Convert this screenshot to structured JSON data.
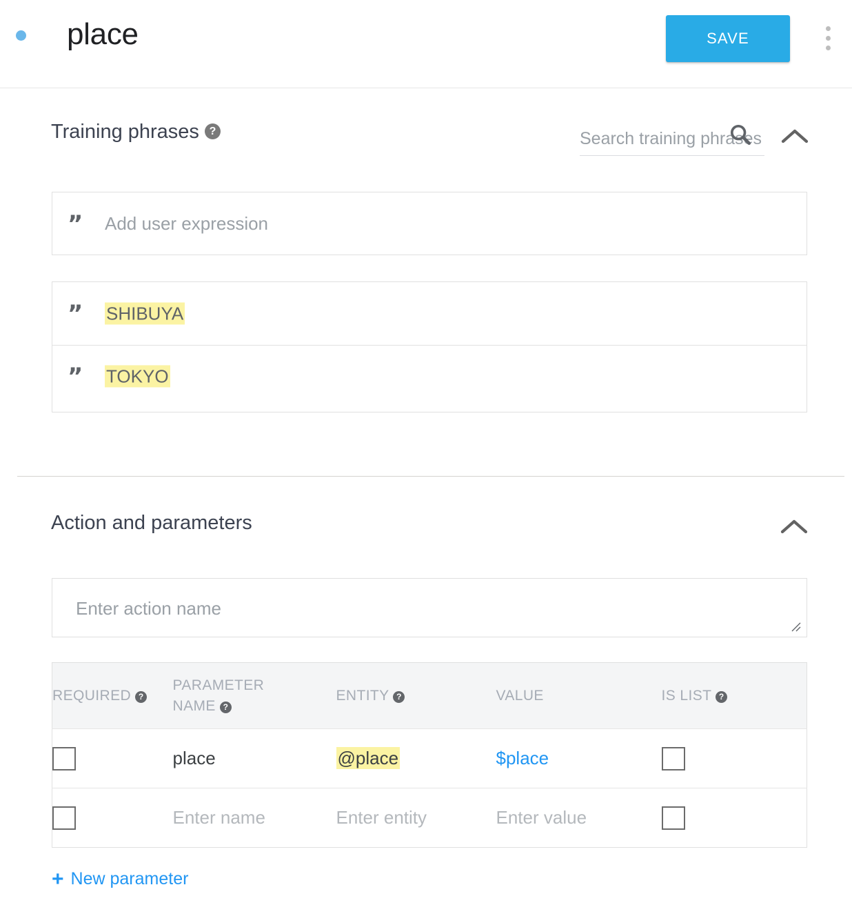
{
  "header": {
    "intent_name": "place",
    "status_dot_color": "#6ab7ea",
    "save_label": "SAVE",
    "more_menu_name": "more-options"
  },
  "training_phrases": {
    "heading": "Training phrases",
    "help_glyph": "?",
    "search_placeholder": "Search training phrases",
    "search_value": "",
    "collapse_glyph": "chevron-up",
    "add_expression_placeholder": "Add user expression",
    "add_expression_value": "",
    "quote_glyph": "”",
    "phrases": [
      {
        "text": "SHIBUYA",
        "highlighted": true
      },
      {
        "text": "TOKYO",
        "highlighted": true
      }
    ],
    "highlight_color": "#fbf3a3"
  },
  "action_parameters": {
    "heading": "Action and parameters",
    "collapse_glyph": "chevron-up",
    "action_name_placeholder": "Enter action name",
    "action_name_value": "",
    "columns": [
      {
        "label": "REQUIRED",
        "help": true
      },
      {
        "label": "PARAMETER NAME",
        "help": true
      },
      {
        "label": "ENTITY",
        "help": true
      },
      {
        "label": "VALUE",
        "help": false
      },
      {
        "label": "IS LIST",
        "help": true
      }
    ],
    "rows": [
      {
        "required_checked": false,
        "name": "place",
        "name_placeholder": "Enter name",
        "entity": "@place",
        "entity_placeholder": "Enter entity",
        "entity_highlighted": true,
        "value": "$place",
        "value_placeholder": "Enter value",
        "value_is_link": true,
        "is_list_checked": false
      },
      {
        "required_checked": false,
        "name": "",
        "name_placeholder": "Enter name",
        "entity": "",
        "entity_placeholder": "Enter entity",
        "entity_highlighted": false,
        "value": "",
        "value_placeholder": "Enter value",
        "value_is_link": false,
        "is_list_checked": false
      }
    ],
    "new_parameter_label": "New parameter",
    "new_parameter_plus": "+",
    "link_color": "#2196f3"
  }
}
